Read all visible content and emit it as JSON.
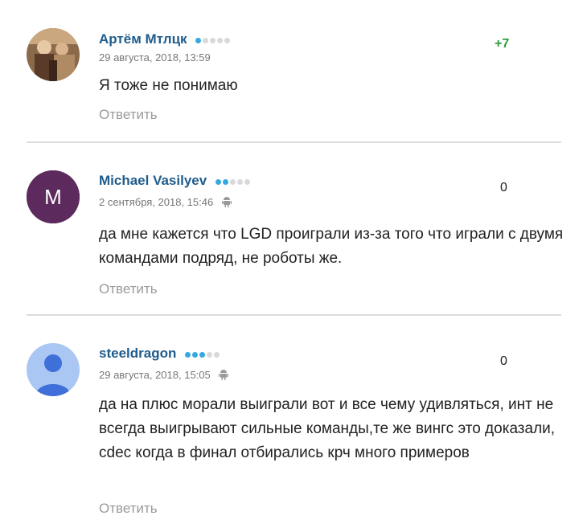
{
  "comments": [
    {
      "author": "Артём Мтлцк",
      "level": 1,
      "date": "29 августа, 2018, 13:59",
      "score": "+7",
      "text": "Я тоже не понимаю",
      "reply_label": "Ответить",
      "avatar": {
        "type": "photo"
      },
      "device": ""
    },
    {
      "author": "Michael Vasilyev",
      "level": 2,
      "date": "2 сентября, 2018, 15:46",
      "score": "0",
      "text": "да мне кажется что LGD проиграли из-за того что играли с двумя командами подряд, не роботы же.",
      "reply_label": "Ответить",
      "avatar": {
        "type": "initial",
        "initial": "M",
        "color": "#5c2a5c"
      },
      "device": "android-icon"
    },
    {
      "author": "steeldragon",
      "level": 3,
      "date": "29 августа, 2018, 15:05",
      "score": "0",
      "text": "да на плюс морали выиграли вот и все чему удивляться, инт не всегда выигрывают сильные команды,те же вингс это доказали, cdec когда в финал отбирались крч много примеров",
      "reply_label": "Ответить",
      "avatar": {
        "type": "default",
        "color": "#a9c7f2"
      },
      "device": "android-icon"
    }
  ],
  "colors": {
    "author": "#1f5c8c",
    "score_positive": "#2f9c3a",
    "reply": "#9a9a9a",
    "level_dot_active": "#35a8e0",
    "level_dot_inactive": "#d9d9d9"
  }
}
